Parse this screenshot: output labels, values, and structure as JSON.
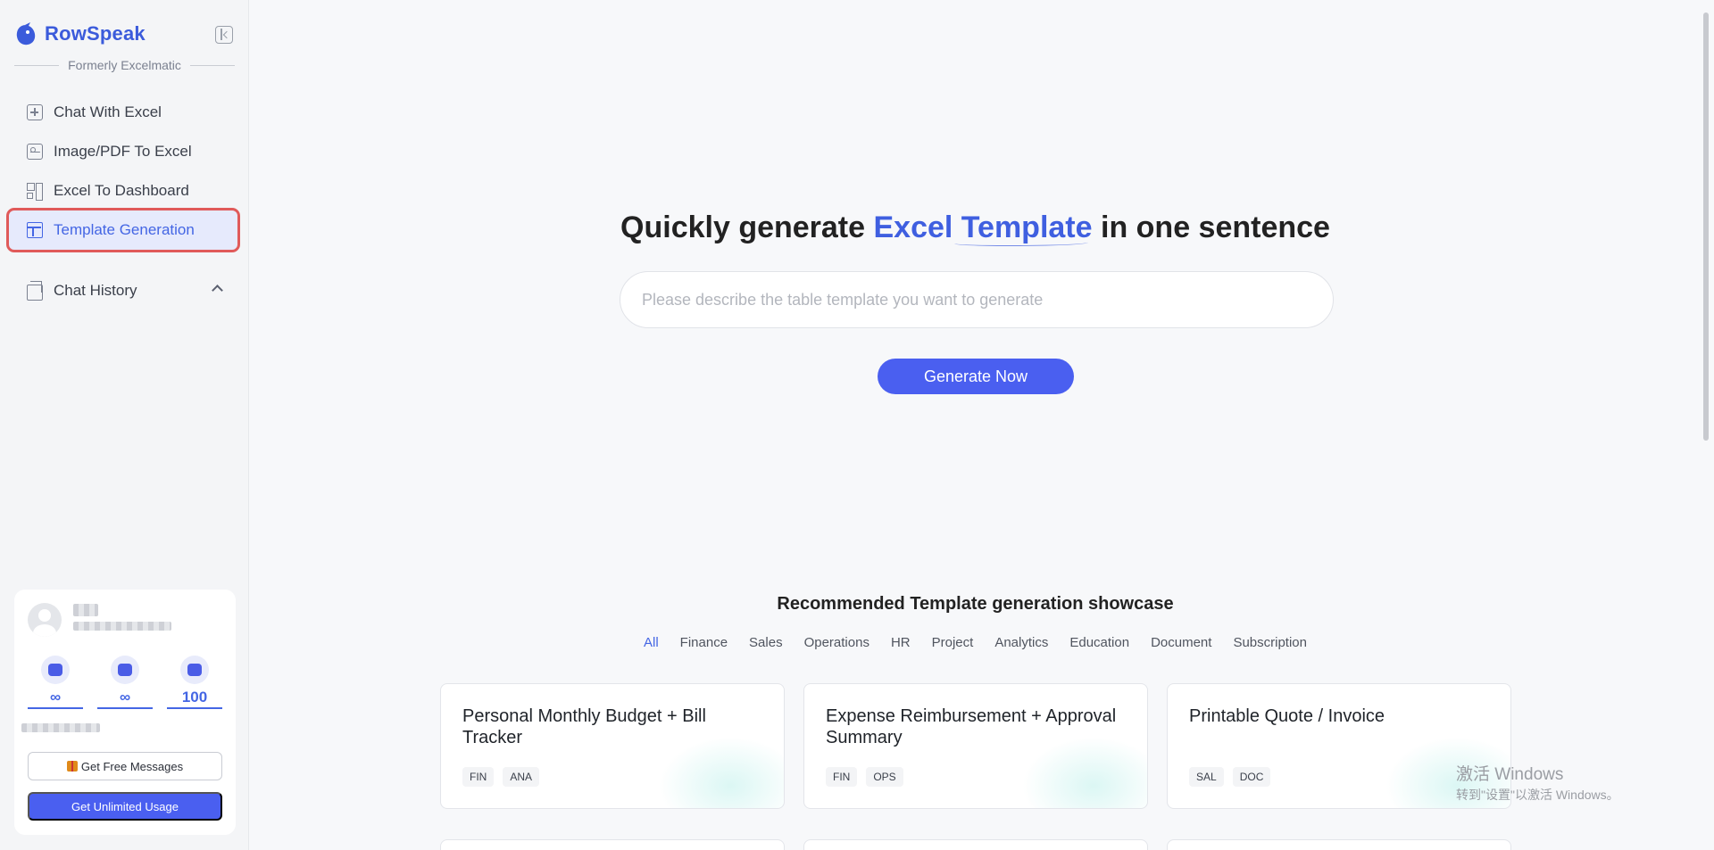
{
  "app": {
    "name": "RowSpeak",
    "formerly": "Formerly Excelmatic"
  },
  "sidebar": {
    "items": [
      {
        "label": "Chat With Excel",
        "icon": "chat-plus-icon"
      },
      {
        "label": "Image/PDF To Excel",
        "icon": "image-icon"
      },
      {
        "label": "Excel To Dashboard",
        "icon": "dashboard-icon"
      },
      {
        "label": "Template Generation",
        "icon": "template-icon",
        "active": true
      }
    ],
    "history_label": "Chat History"
  },
  "user_card": {
    "stats": [
      {
        "icon": "chat-icon",
        "value": "∞"
      },
      {
        "icon": "image-icon",
        "value": "∞"
      },
      {
        "icon": "chart-icon",
        "value": "100"
      }
    ],
    "free_button": "Get Free Messages",
    "unlimited_button": "Get Unlimited Usage"
  },
  "hero": {
    "title_before": "Quickly generate",
    "title_accent": "Excel Template",
    "title_after": "in one sentence",
    "input_placeholder": "Please describe the table template you want to generate",
    "button": "Generate Now"
  },
  "showcase": {
    "title": "Recommended Template generation showcase",
    "filters": [
      "All",
      "Finance",
      "Sales",
      "Operations",
      "HR",
      "Project",
      "Analytics",
      "Education",
      "Document",
      "Subscription"
    ],
    "active_filter": "All",
    "cards": [
      {
        "title": "Personal Monthly Budget + Bill Tracker",
        "tags": [
          "FIN",
          "ANA"
        ]
      },
      {
        "title": "Expense Reimbursement + Approval Summary",
        "tags": [
          "FIN",
          "OPS"
        ]
      },
      {
        "title": "Printable Quote / Invoice",
        "tags": [
          "SAL",
          "DOC"
        ]
      }
    ]
  },
  "watermark": {
    "line1": "激活 Windows",
    "line2": "转到\"设置\"以激活 Windows。"
  },
  "colors": {
    "accent": "#4466e4",
    "button": "#4a5ff0",
    "highlight_border": "#e05a5a"
  }
}
